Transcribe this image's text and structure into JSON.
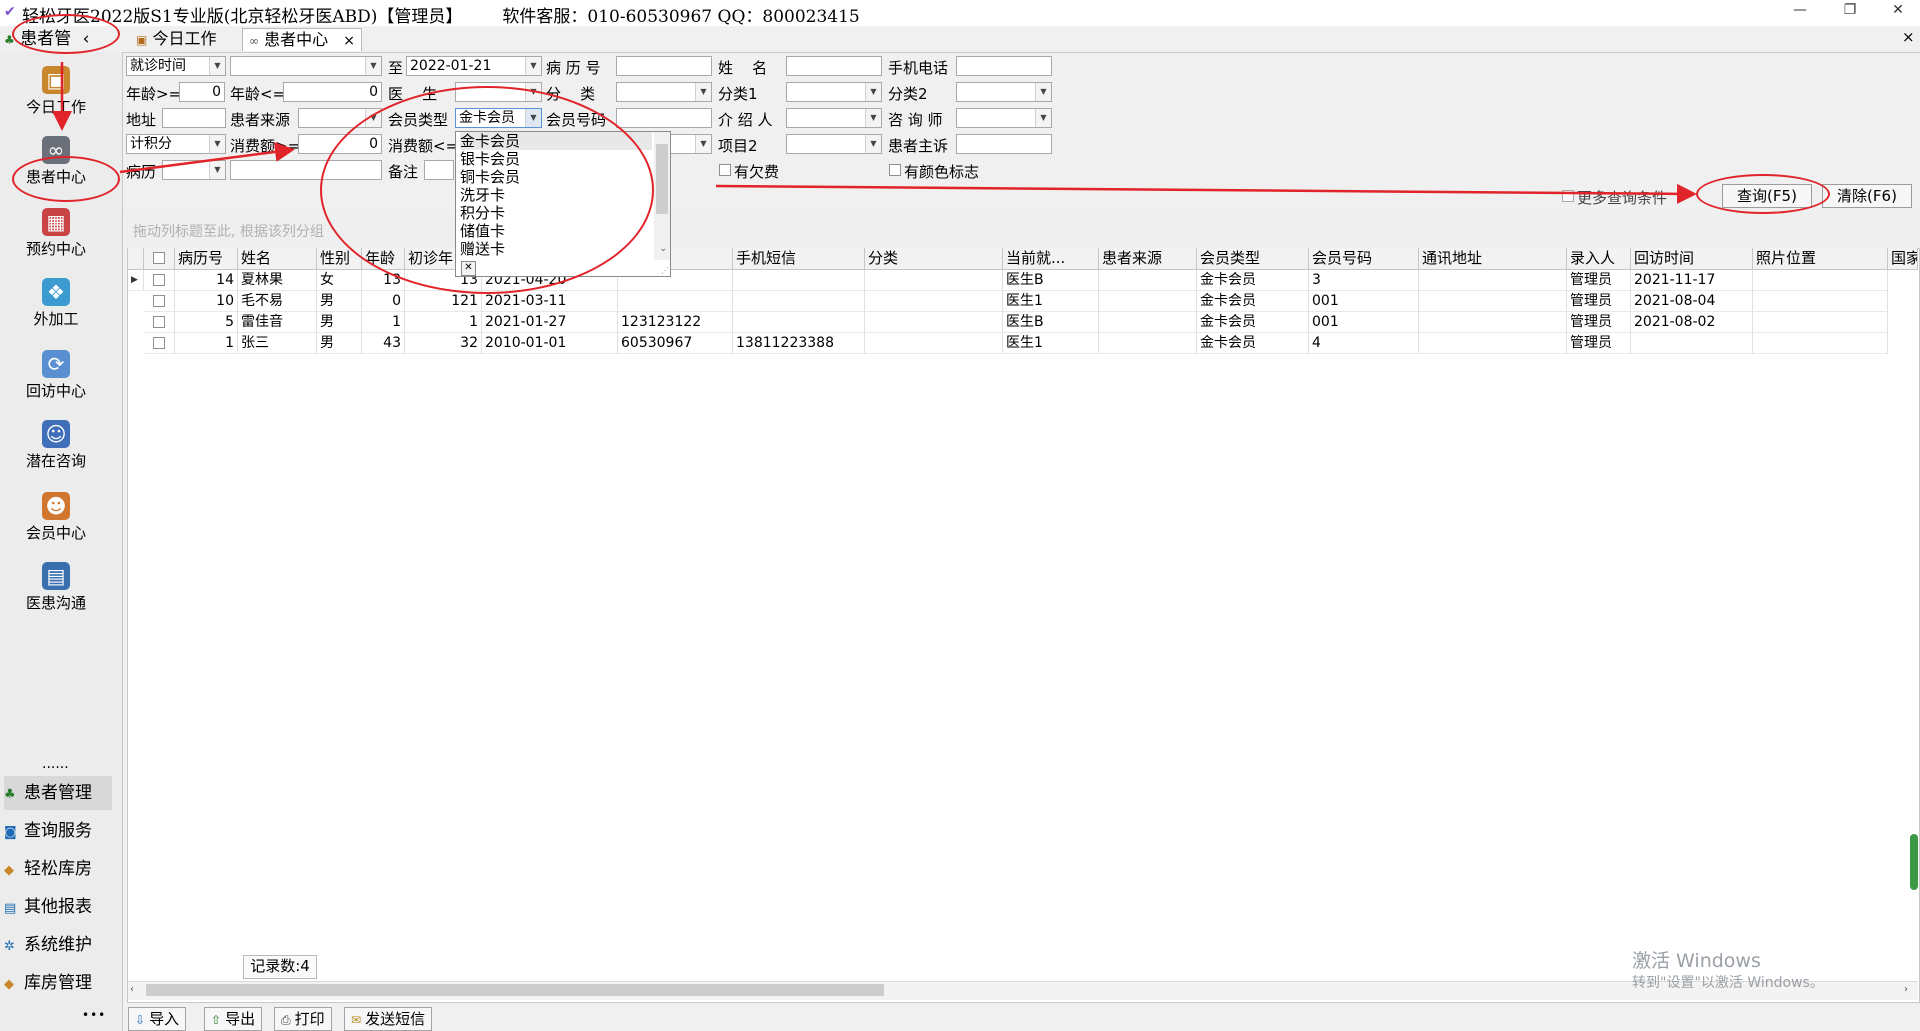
{
  "window": {
    "title": "轻松牙医2022版S1专业版(北京轻松牙医ABD)【管理员】",
    "service": "软件客服：010-60530967  QQ：800023415",
    "minimize": "—",
    "restore": "❐",
    "close": "✕"
  },
  "tabs": {
    "module_tab": "患者管",
    "collapse": "‹",
    "items": [
      {
        "label": "今日工作"
      },
      {
        "label": "患者中心",
        "close": "×"
      }
    ],
    "close_all": "×"
  },
  "sidebar": {
    "items": [
      {
        "label": "今日工作",
        "icon": "briefcase-icon"
      },
      {
        "label": "患者中心",
        "icon": "binoculars-icon"
      },
      {
        "label": "预约中心",
        "icon": "calendar-icon"
      },
      {
        "label": "外加工",
        "icon": "cubes-icon"
      },
      {
        "label": "回访中心",
        "icon": "refresh-icon"
      },
      {
        "label": "潜在咨询",
        "icon": "consultant-icon"
      },
      {
        "label": "会员中心",
        "icon": "members-icon"
      },
      {
        "label": "医患沟通",
        "icon": "film-icon"
      }
    ],
    "dots": "......",
    "modules": [
      {
        "label": "患者管理"
      },
      {
        "label": "查询服务"
      },
      {
        "label": "轻松库房"
      },
      {
        "label": "其他报表"
      },
      {
        "label": "系统维护"
      },
      {
        "label": "库房管理"
      }
    ],
    "more": "•••"
  },
  "filters": {
    "date_type": "就诊时间",
    "date_to_label": "至",
    "date_to": "2022-01-21",
    "record_no_label": "病 历 号",
    "name_label": "姓    名",
    "mobile_label": "手机电话",
    "age_min_label": "年龄>=",
    "age_min": "0",
    "age_max_label": "年龄<=",
    "age_max": "0",
    "doctor_label": "医    生",
    "category_label": "分    类",
    "category1_label": "分类1",
    "category2_label": "分类2",
    "address_label": "地址",
    "source_label": "患者来源",
    "member_type_label": "会员类型",
    "member_type": "金卡会员",
    "member_no_label": "会员号码",
    "referrer_label": "介 绍 人",
    "consultant_label": "咨 询 师",
    "points_type": "计积分",
    "spend_min_label": "消费额>=",
    "spend_min": "0",
    "spend_max_label": "消费额<=",
    "item2_label": "项目2",
    "complaint_label": "患者主诉",
    "history_label": "病历",
    "remark_label": "备注",
    "arrears_label": "有欠费",
    "color_flag_label": "有颜色标志",
    "more_conditions_label": "更多查询条件",
    "query_button": "查询(F5)",
    "clear_button": "清除(F6)"
  },
  "member_type_options": [
    "金卡会员",
    "银卡会员",
    "铜卡会员",
    "洗牙卡",
    "积分卡",
    "储值卡",
    "赠送卡"
  ],
  "grid": {
    "group_hint": "拖动列标题至此, 根据该列分组",
    "columns": [
      "病历号",
      "姓名",
      "性别",
      "年龄",
      "初诊年",
      "",
      "手机短信",
      "分类",
      "当前就...",
      "患者来源",
      "会员类型",
      "会员号码",
      "通讯地址",
      "录入人",
      "回访时间",
      "照片位置",
      "国家"
    ],
    "rows": [
      {
        "no": "14",
        "name": "夏林果",
        "sex": "女",
        "age": "13",
        "first_age": "13",
        "first_date": "2021-04-20",
        "phone": "",
        "sms": "",
        "category": "",
        "doctor": "医生B",
        "source": "",
        "member_type": "金卡会员",
        "member_no": "3",
        "address": "",
        "entered_by": "管理员",
        "visit_time": "2021-11-17",
        "photo": ""
      },
      {
        "no": "10",
        "name": "毛不易",
        "sex": "男",
        "age": "0",
        "first_age": "121",
        "first_date": "2021-03-11",
        "phone": "",
        "sms": "",
        "category": "",
        "doctor": "医生1",
        "source": "",
        "member_type": "金卡会员",
        "member_no": "001",
        "address": "",
        "entered_by": "管理员",
        "visit_time": "2021-08-04",
        "photo": ""
      },
      {
        "no": "5",
        "name": "雷佳音",
        "sex": "男",
        "age": "1",
        "first_age": "1",
        "first_date": "2021-01-27",
        "phone": "123123122",
        "sms": "",
        "category": "",
        "doctor": "医生B",
        "source": "",
        "member_type": "金卡会员",
        "member_no": "001",
        "address": "",
        "entered_by": "管理员",
        "visit_time": "2021-08-02",
        "photo": ""
      },
      {
        "no": "1",
        "name": "张三",
        "sex": "男",
        "age": "43",
        "first_age": "32",
        "first_date": "2010-01-01",
        "phone": "60530967",
        "sms": "13811223388",
        "category": "",
        "doctor": "医生1",
        "source": "",
        "member_type": "金卡会员",
        "member_no": "4",
        "address": "",
        "entered_by": "管理员",
        "visit_time": "",
        "photo": ""
      }
    ],
    "record_count": "记录数:4"
  },
  "toolbar": {
    "import": "导入",
    "export": "导出",
    "print": "打印",
    "sms": "发送短信"
  },
  "watermark": {
    "line1": "激活 Windows",
    "line2": "转到\"设置\"以激活 Windows。"
  },
  "colors": {
    "annotation_red": "#e0242a"
  }
}
